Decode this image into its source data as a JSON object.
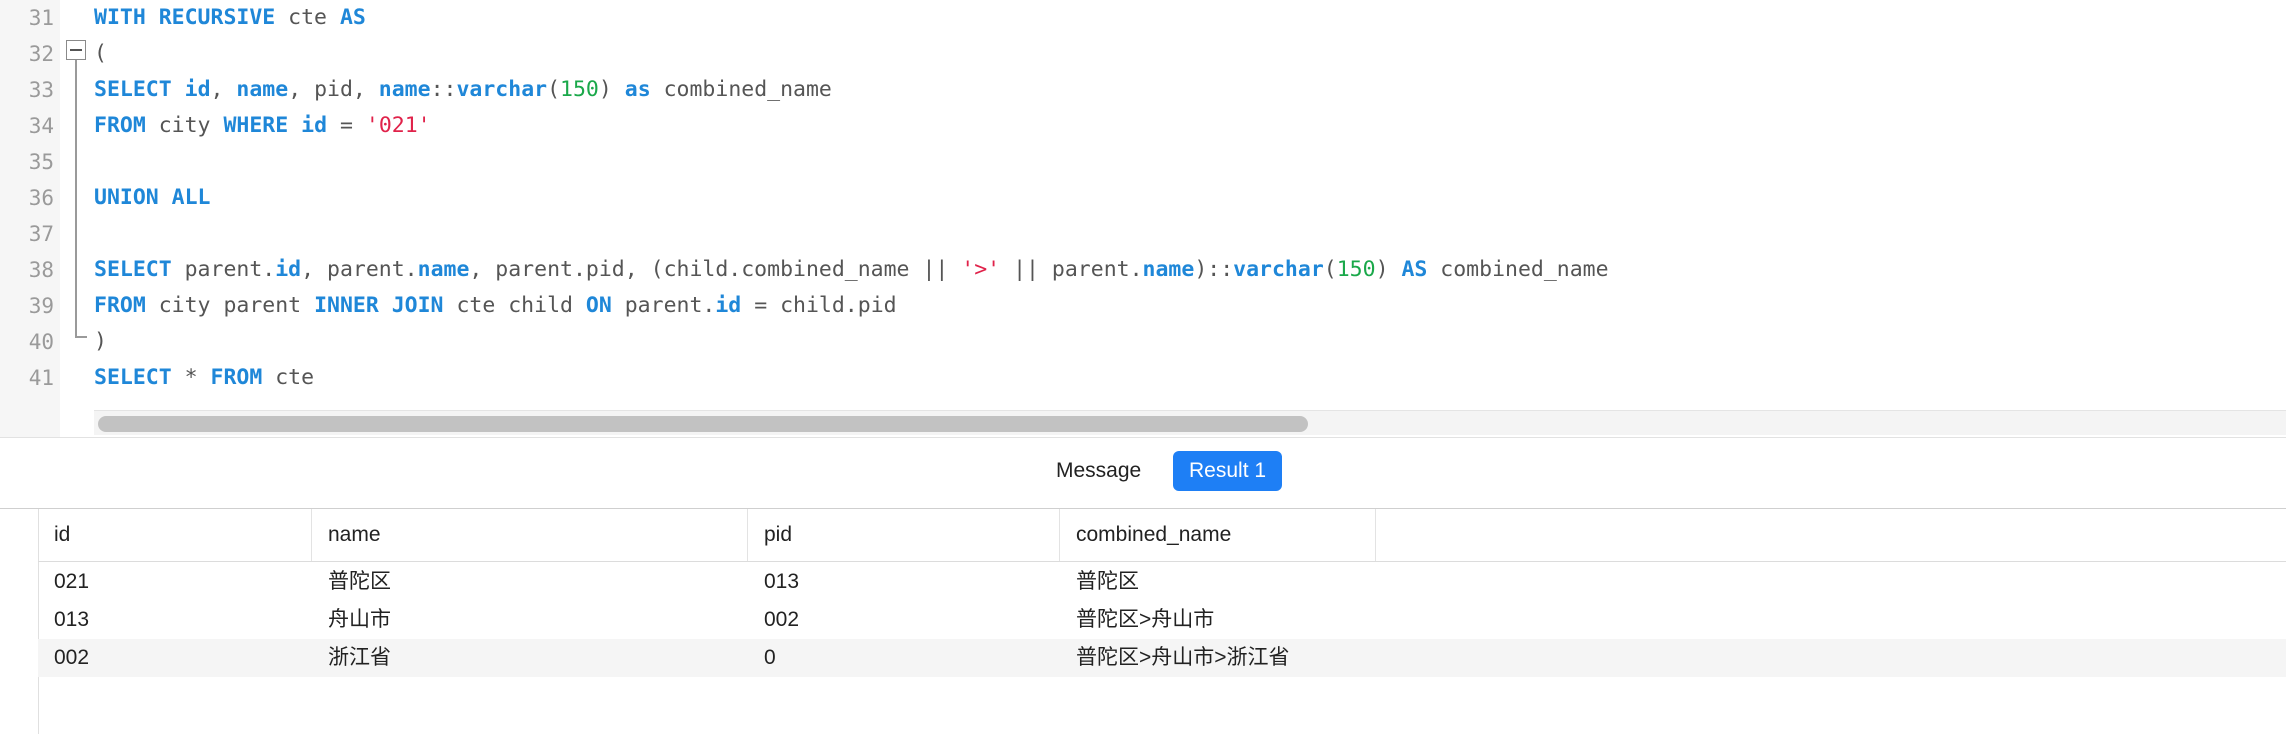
{
  "editor": {
    "line_numbers": [
      "31",
      "32",
      "33",
      "34",
      "35",
      "36",
      "37",
      "38",
      "39",
      "40",
      "41"
    ]
  },
  "tabs": {
    "message": "Message",
    "result": "Result 1"
  },
  "results": {
    "columns": [
      "id",
      "name",
      "pid",
      "combined_name"
    ],
    "rows": [
      [
        "021",
        "普陀区",
        "013",
        "普陀区"
      ],
      [
        "013",
        "舟山市",
        "002",
        "普陀区>舟山市"
      ],
      [
        "002",
        "浙江省",
        "0",
        "普陀区>舟山市>浙江省"
      ]
    ]
  }
}
